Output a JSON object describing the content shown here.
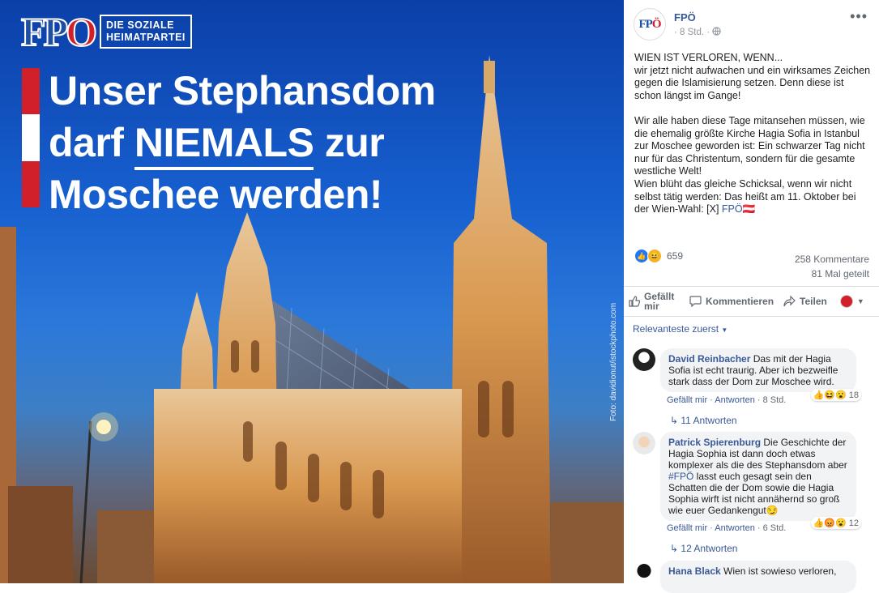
{
  "image": {
    "logo_text": "FPÖ",
    "logo_tagline_1": "DIE SOZIALE",
    "logo_tagline_2": "HEIMATPARTEI",
    "headline_1": "Unser Stephansdom",
    "headline_2a": "darf ",
    "headline_2b": "NIEMALS",
    "headline_2c": " zur",
    "headline_3": "Moschee werden!",
    "credit": "Foto: davidionut/istockphoto.com",
    "colors": {
      "red": "#d2202b",
      "blue": "#1f4fa3"
    }
  },
  "post": {
    "author": "FPÖ",
    "time": "8 Std.",
    "privacy_icon": "globe-icon",
    "text_1": "WIEN IST VERLOREN, WENN...\nwir jetzt nicht aufwachen und ein wirksames Zeichen gegen die Islamisierung setzen. Denn diese ist schon längst im Gange!\n\nWir alle haben diese Tage mitansehen müssen, wie die ehemalig größte Kirche Hagia Sofia in Istanbul zur Moschee geworden ist: Ein schwarzer Tag nicht nur für das Christentum, sondern für die gesamte westliche Welt!\nWien blüht das gleiche Schicksal, wenn wir nicht selbst tätig werden: Das heißt am 11. Oktober bei der Wien-Wahl: [X] ",
    "text_link": "FPÖ",
    "text_flag": "🇦🇹",
    "reactions_count": "659",
    "comments_count": "258 Kommentare",
    "shares_count": "81 Mal geteilt",
    "like_label": "Gefällt mir",
    "comment_label": "Kommentieren",
    "share_label": "Teilen",
    "sort_label": "Relevanteste zuerst"
  },
  "comments": [
    {
      "name": "David Reinbacher",
      "text": " Das mit der Hagia Sofia ist echt traurig. Aber ich bezweifle stark dass der Dom zur Moschee wird.",
      "like": "Gefällt mir",
      "reply": "Antworten",
      "time": "8 Std.",
      "reactions": "18",
      "replies": "11 Antworten"
    },
    {
      "name": "Patrick Spierenburg",
      "text_1": " Die Geschichte der Hagia Sophia ist dann doch etwas komplexer als die des Stephansdom aber ",
      "hashtag": "#FPÖ",
      "text_2": " lasst euch gesagt sein den Schatten die der Dom sowie die Hagia Sophia wirft ist nicht annähernd so groß wie euer Gedankengut😏",
      "like": "Gefällt mir",
      "reply": "Antworten",
      "time": "6 Std.",
      "reactions": "12",
      "replies": "12 Antworten"
    },
    {
      "name": "Hana Black",
      "text": " Wien ist sowieso verloren,"
    }
  ]
}
